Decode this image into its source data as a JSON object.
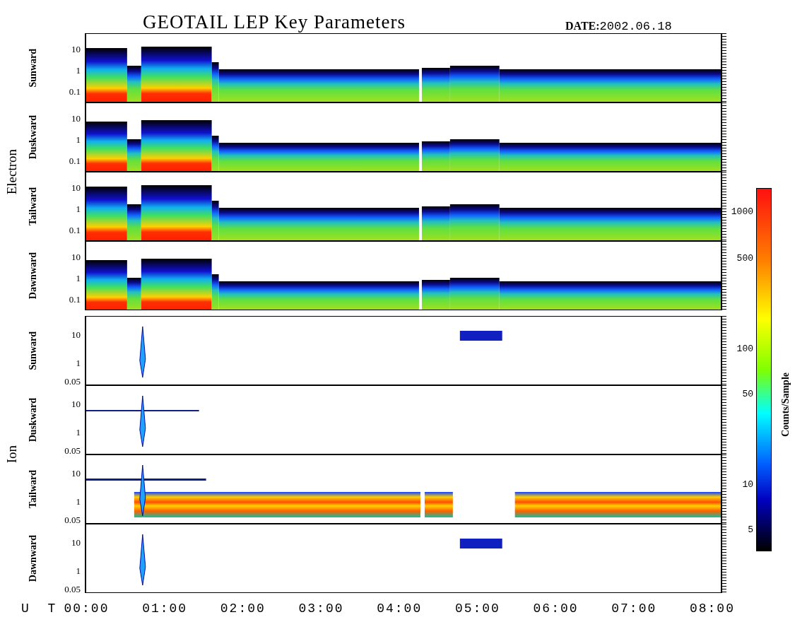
{
  "title": "GEOTAIL LEP Key Parameters",
  "date": {
    "label": "DATE:",
    "value": "2002.06.18"
  },
  "groups": [
    {
      "label": "Electron",
      "kind": "electron",
      "panels": [
        {
          "label": "Sunward",
          "yticks": [
            "10",
            "1",
            "0.1"
          ]
        },
        {
          "label": "Duskward",
          "yticks": [
            "10",
            "1",
            "0.1"
          ]
        },
        {
          "label": "Tailward",
          "yticks": [
            "10",
            "1",
            "0.1"
          ]
        },
        {
          "label": "Dawnward",
          "yticks": [
            "10",
            "1",
            "0.1"
          ]
        }
      ]
    },
    {
      "label": "Ion",
      "kind": "ion",
      "panels": [
        {
          "label": "Sunward",
          "yticks": [
            "10",
            "1",
            "0.05"
          ]
        },
        {
          "label": "Duskward",
          "yticks": [
            "10",
            "1",
            "0.05"
          ]
        },
        {
          "label": "Tailward",
          "yticks": [
            "10",
            "1",
            "0.05"
          ]
        },
        {
          "label": "Dawnward",
          "yticks": [
            "10",
            "1",
            "0.05"
          ]
        }
      ]
    }
  ],
  "x_axis": {
    "label": "U T",
    "ticks": [
      "00:00",
      "01:00",
      "02:00",
      "03:00",
      "04:00",
      "05:00",
      "06:00",
      "07:00",
      "08:00"
    ]
  },
  "colorbar": {
    "label": "Counts/Sample",
    "ticks": [
      "1000",
      "500",
      "100",
      "50",
      "10",
      "5"
    ]
  }
}
